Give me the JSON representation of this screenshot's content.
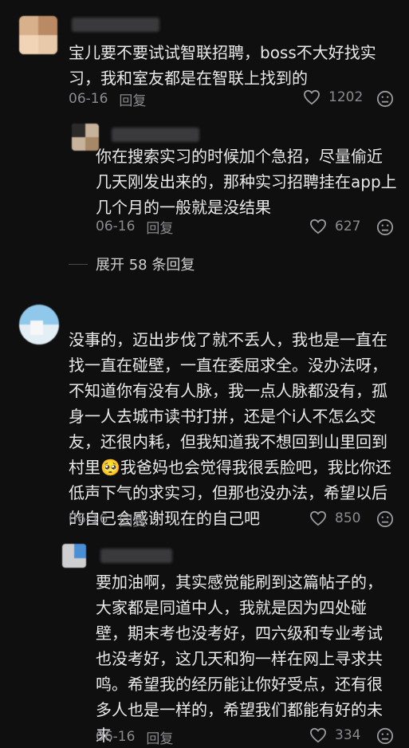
{
  "comments": [
    {
      "text": "宝儿要不要试试智联招聘，boss不大好找实\n习，我和室友都是在智联上找到的",
      "date": "06-16",
      "reply_label": "回复",
      "likes": "1202"
    },
    {
      "text": "你在搜索实习的时候加个急招，尽量偷近\n几天刚发出来的，那种实习招聘挂在app上\n几个月的一般就是没结果",
      "date": "06-16",
      "reply_label": "回复",
      "likes": "627"
    },
    {
      "text": "没事的，迈出步伐了就不丢人，我也是一直在\n找一直在碰壁，一直在委屈求全。没办法呀，\n不知道你有没有人脉，我一点人脉都没有，孤\n身一人去城市读书打拼，还是个i人不怎么交\n友，还很内耗，但我知道我不想回到山里回到\n村里🥺我爸妈也会觉得我很丢脸吧，我比你还\n低声下气的求实习，但那也没办法，希望以后\n的自己会感谢现在的自己吧",
      "date": "06-16",
      "reply_label": "回复",
      "likes": "850"
    },
    {
      "text": "要加油啊，其实感觉能刷到这篇帖子的，\n大家都是同道中人，我就是因为四处碰\n壁，期末考也没考好，四六级和专业考试\n也没考好，这几天和狗一样在网上寻求共\n鸣。希望我的经历能让你好受点，还有很\n多人也是一样的，希望我们都能有好的未\n来",
      "date": "06-16",
      "reply_label": "回复",
      "likes": "334"
    }
  ],
  "expand_replies": "展开 58 条回复",
  "icons": {
    "like": "heart-outline-icon",
    "dislike": "frown-face-icon"
  },
  "colors": {
    "background": "#0f0f10",
    "text": "#e9e9ea",
    "meta": "#8b8b8f"
  }
}
